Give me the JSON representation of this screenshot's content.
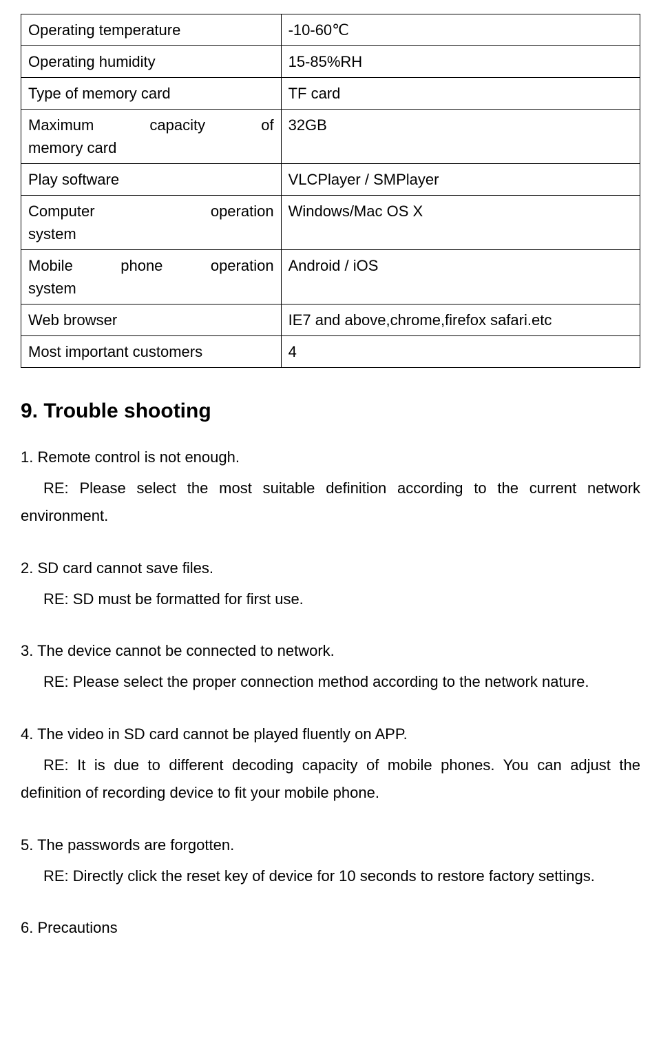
{
  "table": {
    "rows": [
      {
        "col1": "Operating temperature",
        "col2": "-10-60℃"
      },
      {
        "col1": "Operating humidity",
        "col2": "15-85%RH"
      },
      {
        "col1": "Type of memory card",
        "col2": "TF card"
      },
      {
        "col1": "Maximum capacity of memory card",
        "col2": "32GB"
      },
      {
        "col1": "Play software",
        "col2": "VLCPlayer / SMPlayer"
      },
      {
        "col1": "Computer operation system",
        "col2": "Windows/Mac OS X"
      },
      {
        "col1": "Mobile phone operation system",
        "col2": "Android / iOS"
      },
      {
        "col1": "Web browser",
        "col2": "IE7 and above,chrome,firefox safari.etc"
      },
      {
        "col1": "Most important customers",
        "col2": "4"
      }
    ]
  },
  "heading1": "9. Trouble shooting",
  "items": {
    "i1": {
      "q": "1. Remote control is not enough.",
      "a": "RE: Please select the most suitable definition according to the current network environment."
    },
    "i2": {
      "q": "2. SD card cannot save files.",
      "a": "RE: SD must be formatted for first use."
    },
    "i3": {
      "q": "3. The device cannot be connected to network.",
      "a": "RE: Please select the proper connection method according to the network nature."
    },
    "i4": {
      "q": "4. The video in SD card cannot be played fluently on APP.",
      "a": "RE: It is due to different decoding capacity of mobile phones. You can adjust the definition of recording device to fit your mobile phone."
    },
    "i5": {
      "q": "5. The passwords are forgotten.",
      "a": "RE: Directly click the reset key of device for 10 seconds to restore factory settings."
    }
  },
  "footer": "6. Precautions"
}
